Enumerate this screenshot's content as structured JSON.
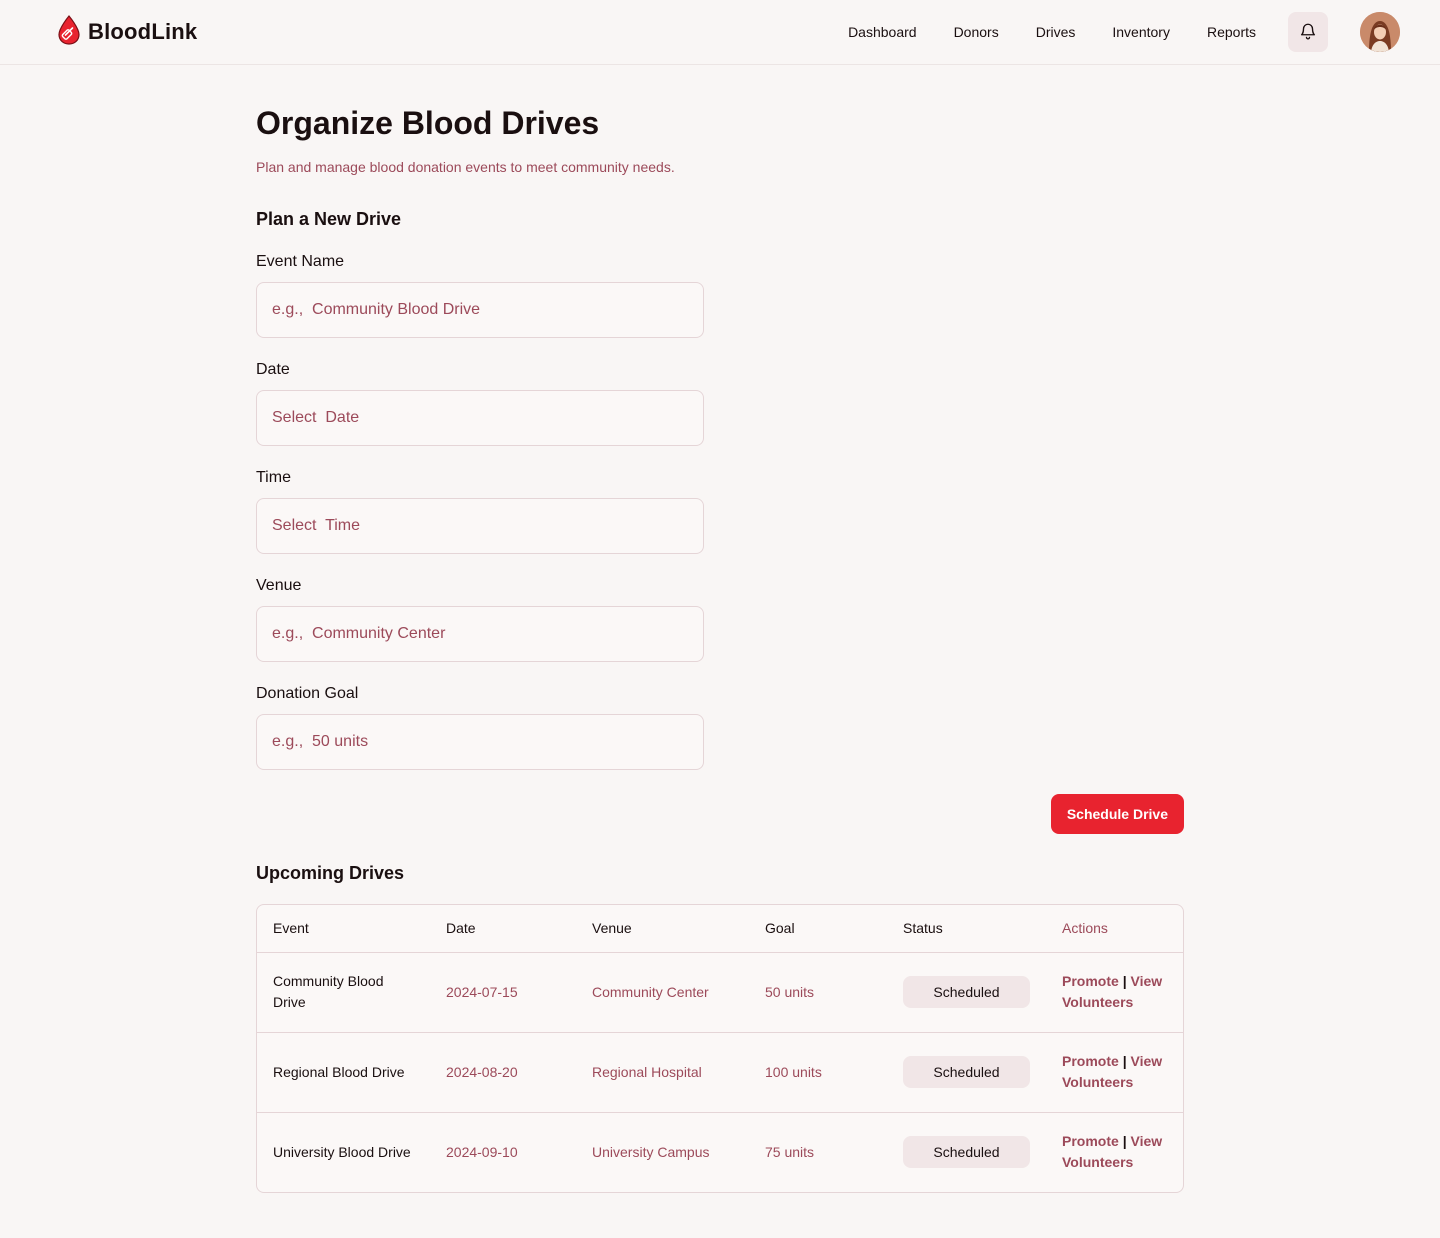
{
  "app": {
    "name": "BloodLink"
  },
  "nav": {
    "items": [
      {
        "label": "Dashboard"
      },
      {
        "label": "Donors"
      },
      {
        "label": "Drives"
      },
      {
        "label": "Inventory"
      },
      {
        "label": "Reports"
      }
    ],
    "notification_icon": "bell-icon",
    "avatar_icon": "user-avatar"
  },
  "page": {
    "title": "Organize Blood Drives",
    "subtitle": "Plan and manage blood donation events to meet community needs."
  },
  "form": {
    "title": "Plan a New Drive",
    "fields": {
      "event_name": {
        "label": "Event Name",
        "placeholder": "e.g.,  Community Blood Drive",
        "value": ""
      },
      "date": {
        "label": "Date",
        "placeholder": "Select  Date",
        "value": ""
      },
      "time": {
        "label": "Time",
        "placeholder": "Select  Time",
        "value": ""
      },
      "venue": {
        "label": "Venue",
        "placeholder": "e.g.,  Community Center",
        "value": ""
      },
      "goal": {
        "label": "Donation Goal",
        "placeholder": "e.g.,  50 units",
        "value": ""
      }
    },
    "submit_label": "Schedule Drive"
  },
  "upcoming": {
    "title": "Upcoming Drives",
    "columns": [
      "Event",
      "Date",
      "Venue",
      "Goal",
      "Status",
      "Actions"
    ],
    "rows": [
      {
        "event": "Community Blood Drive",
        "date": "2024-07-15",
        "venue": "Community Center",
        "goal": "50 units",
        "status": "Scheduled",
        "promote": "Promote",
        "sep": "|",
        "view": "View Volunteers"
      },
      {
        "event": "Regional Blood Drive",
        "date": "2024-08-20",
        "venue": "Regional Hospital",
        "goal": "100 units",
        "status": "Scheduled",
        "promote": "Promote",
        "sep": "|",
        "view": "View Volunteers"
      },
      {
        "event": "University Blood Drive",
        "date": "2024-09-10",
        "venue": "University Campus",
        "goal": "75 units",
        "status": "Scheduled",
        "promote": "Promote",
        "sep": "|",
        "view": "View Volunteers"
      }
    ]
  },
  "colors": {
    "accent": "#e8232f",
    "muted_text": "#9c4a5a",
    "background": "#f9f6f5",
    "border": "#e5d5d7",
    "chip": "#f1e6e7"
  }
}
